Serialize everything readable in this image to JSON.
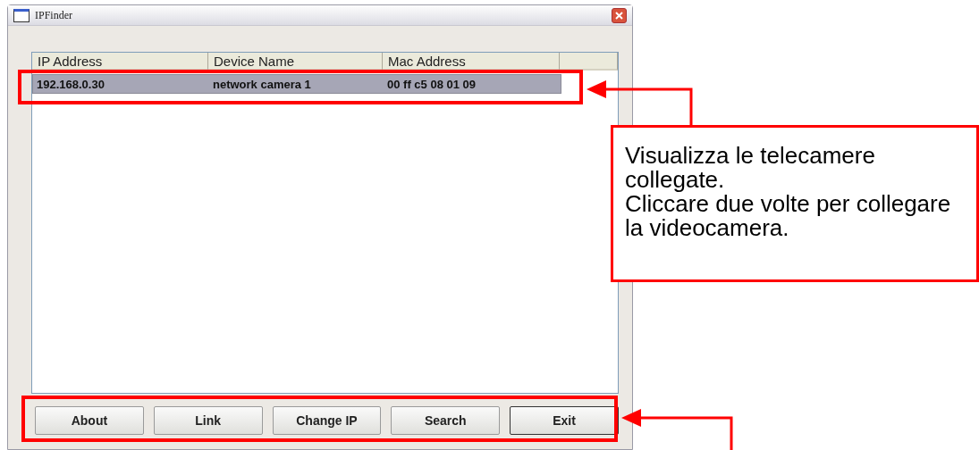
{
  "window": {
    "title": "IPFinder"
  },
  "table": {
    "columns": [
      "IP Address",
      "Device Name",
      "Mac Address"
    ],
    "rows": [
      {
        "cells": [
          "192.168.0.30",
          "network camera 1",
          "00 ff c5 08 01 09"
        ],
        "selected": true
      }
    ]
  },
  "buttons": [
    "About",
    "Link",
    "Change IP",
    "Search",
    "Exit"
  ],
  "callout": {
    "lines": [
      "Visualizza le telecamere collegate.",
      "Cliccare due volte per collegare la videocamera."
    ]
  }
}
